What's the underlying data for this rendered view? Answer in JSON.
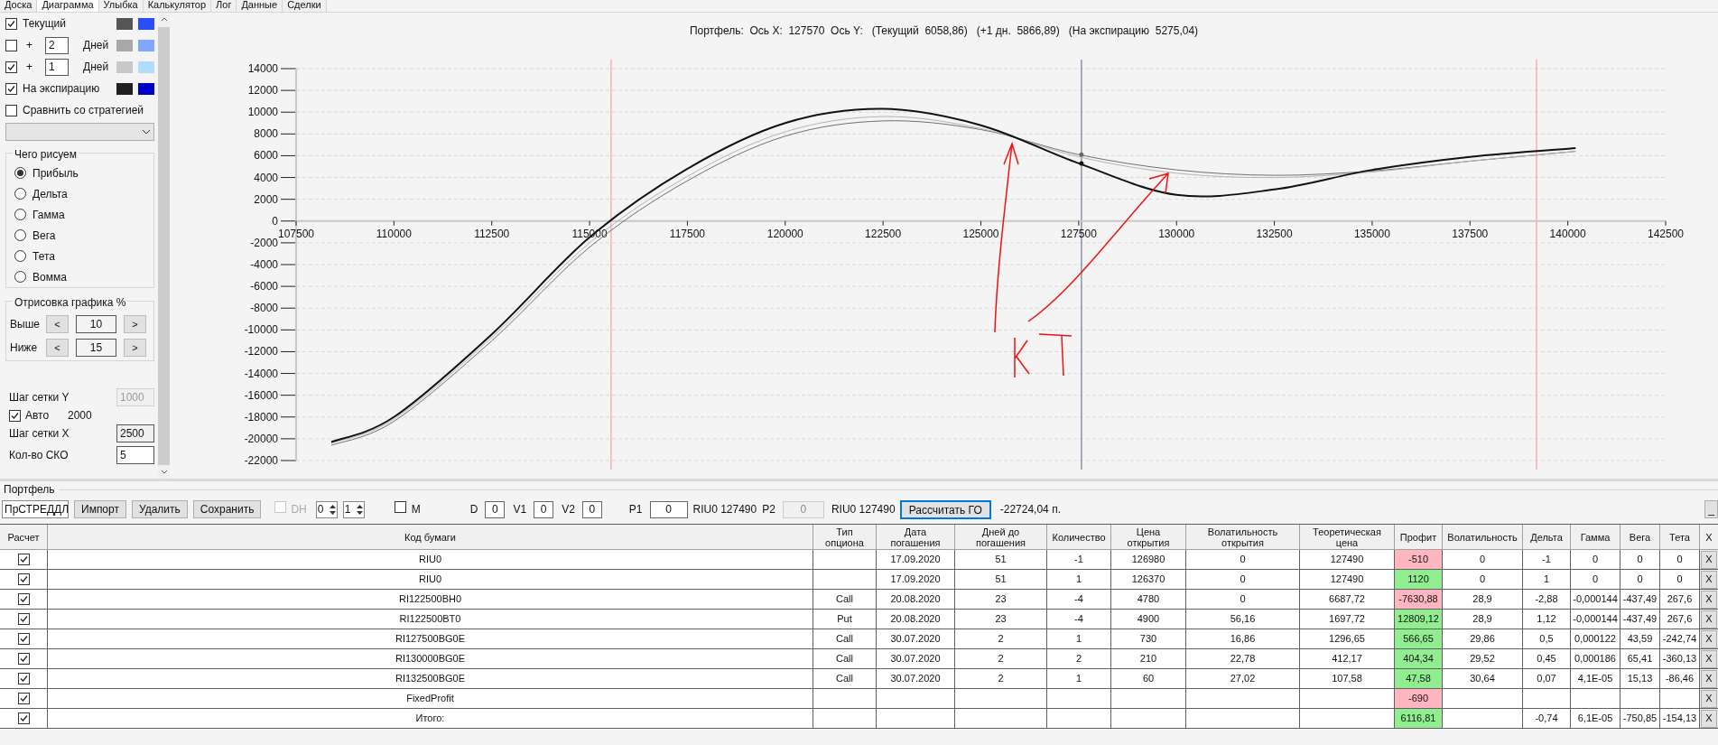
{
  "tabs": [
    {
      "label": "Доска",
      "selected": false
    },
    {
      "label": "Диаграмма",
      "selected": true
    },
    {
      "label": "Улыбка",
      "selected": false
    },
    {
      "label": "Калькулятор",
      "selected": false
    },
    {
      "label": "Лог",
      "selected": false
    },
    {
      "label": "Данные",
      "selected": false
    },
    {
      "label": "Сделки",
      "selected": false
    }
  ],
  "display_rows": [
    {
      "kind": "label",
      "label": "Текущий",
      "checked": true,
      "swatches": [
        {
          "color": "#555555"
        },
        {
          "color": "#2a4dff"
        }
      ]
    },
    {
      "kind": "days",
      "checked": false,
      "prefix": "+",
      "value": "2",
      "unit": "Дней",
      "swatches": [
        {
          "color": "#a8a8a8"
        },
        {
          "color": "#80a8ff"
        }
      ]
    },
    {
      "kind": "days",
      "checked": true,
      "prefix": "+",
      "value": "1",
      "unit": "Дней",
      "swatches": [
        {
          "color": "#c8c8c8"
        },
        {
          "color": "#b0dcff"
        }
      ]
    },
    {
      "kind": "label",
      "label": "На экспирацию",
      "checked": true,
      "swatches": [
        {
          "color": "#202020"
        },
        {
          "color": "#0000c8"
        }
      ]
    },
    {
      "kind": "label",
      "label": "Сравнить со стратегией",
      "checked": false
    }
  ],
  "plot_group": {
    "title": "Чего рисуем",
    "options": [
      {
        "label": "Прибыль",
        "selected": true
      },
      {
        "label": "Дельта",
        "selected": false
      },
      {
        "label": "Гамма",
        "selected": false
      },
      {
        "label": "Вега",
        "selected": false
      },
      {
        "label": "Тета",
        "selected": false
      },
      {
        "label": "Вомма",
        "selected": false
      }
    ]
  },
  "range_group": {
    "title": "Отрисовка графика %",
    "rows": [
      {
        "label": "Выше",
        "dec": "<",
        "value": "10",
        "inc": ">"
      },
      {
        "label": "Ниже",
        "dec": "<",
        "value": "15",
        "inc": ">"
      }
    ]
  },
  "grid_settings": [
    {
      "kind": "field",
      "label": "Шаг сетки Y",
      "value": "1000",
      "disabled": true,
      "readonly": false
    },
    {
      "kind": "check",
      "label": "Авто",
      "checked": true,
      "value": "2000"
    },
    {
      "kind": "field",
      "label": "Шаг сетки X",
      "value": "2500",
      "disabled": false,
      "readonly": true
    },
    {
      "kind": "field",
      "label": "Кол-во СКО",
      "value": "5",
      "disabled": false,
      "readonly": false
    }
  ],
  "chart": {
    "title": "Портфель:  Ось X:  127570  Ось Y:   (Текущий  6058,86)   (+1 дн.  5866,89)   (На экспирацию  5275,04)",
    "chart_data": {
      "type": "line",
      "x": [
        108400,
        110000,
        112500,
        115000,
        117500,
        120000,
        122500,
        125000,
        127500,
        130000,
        132500,
        135000,
        137500,
        140200
      ],
      "series": [
        {
          "color": "#707070",
          "values": [
            -20600,
            -18400,
            -11000,
            -2400,
            3700,
            7800,
            9200,
            8400,
            6100,
            4700,
            4200,
            4600,
            5500,
            6400
          ]
        },
        {
          "color": "#b4b4b4",
          "values": [
            -20400,
            -18200,
            -10700,
            -2000,
            4100,
            8200,
            9600,
            8500,
            5900,
            4400,
            4000,
            4500,
            5500,
            6400
          ]
        },
        {
          "color": "#111111",
          "values": [
            -20300,
            -18000,
            -10400,
            -1500,
            4800,
            9000,
            10300,
            8800,
            5300,
            2400,
            2900,
            4700,
            5900,
            6700
          ]
        }
      ],
      "xlim": [
        107500,
        142500
      ],
      "ylim": [
        -22000,
        14000
      ],
      "xticks": [
        107500,
        110000,
        112500,
        115000,
        117500,
        120000,
        122500,
        125000,
        127500,
        130000,
        132500,
        135000,
        137500,
        140000,
        142500
      ],
      "yticks": [
        14000,
        12000,
        10000,
        8000,
        6000,
        4000,
        2000,
        0,
        -2000,
        -4000,
        -6000,
        -8000,
        -10000,
        -12000,
        -14000,
        -16000,
        -18000,
        -20000,
        -22000
      ],
      "grid": true,
      "ref_lines": [
        {
          "axis": "x",
          "value": 115550,
          "color": "#ff8c8c"
        },
        {
          "axis": "x",
          "value": 139200,
          "color": "#ff8c8c"
        },
        {
          "axis": "x",
          "value": 127570,
          "color": "#8a94a6"
        }
      ]
    }
  },
  "portfolio": {
    "title": "Портфель",
    "strategy": "ПрСТРЕДДЛ",
    "buttons": [
      "Импорт",
      "Удалить",
      "Сохранить"
    ],
    "dh": {
      "label": "DH",
      "checked": false,
      "disabled": true
    },
    "spinners": [
      "0",
      "1"
    ],
    "m": {
      "label": "M",
      "checked": false
    },
    "params": [
      {
        "label": "D",
        "value": "0"
      },
      {
        "label": "V1",
        "value": "0"
      },
      {
        "label": "V2",
        "value": "0"
      },
      {
        "label": "P1",
        "value": "0"
      }
    ],
    "p1_info": "RIU0 127490",
    "p2": {
      "label": "P2",
      "value": "0",
      "disabled": true
    },
    "p2_info": "RIU0 127490",
    "calc_button": "Рассчитать ГО",
    "margin": "-22724,04 п.",
    "minimize": "_"
  },
  "table": {
    "columns": [
      "Расчет",
      "Код бумаги",
      "Тип опциона",
      "Дата погашения",
      "Дней до погашения",
      "Количество",
      "Цена открытия",
      "Волатильность открытия",
      "Теоретическая цена",
      "Профит",
      "Волатильность",
      "Дельта",
      "Гамма",
      "Вега",
      "Тета",
      "X"
    ],
    "rows": [
      {
        "checked": true,
        "code": "RIU0",
        "expiry": "17.09.2020",
        "days": "51",
        "qty": "-1",
        "open_price": "126980",
        "open_vol": "0",
        "theo": "127490",
        "profit": "-510",
        "color": "#ffb6c1",
        "vol": "0",
        "delta": "-1",
        "gamma": "0",
        "vega": "0",
        "theta": "0",
        "delete": "X"
      },
      {
        "checked": true,
        "code": "RIU0",
        "expiry": "17.09.2020",
        "days": "51",
        "qty": "1",
        "open_price": "126370",
        "open_vol": "0",
        "theo": "127490",
        "profit": "1120",
        "color": "#90ee90",
        "vol": "0",
        "delta": "1",
        "gamma": "0",
        "vega": "0",
        "theta": "0",
        "delete": "X"
      },
      {
        "checked": true,
        "code": "RI122500BH0",
        "type": "Call",
        "expiry": "20.08.2020",
        "days": "23",
        "qty": "-4",
        "open_price": "4780",
        "open_vol": "0",
        "theo": "6687,72",
        "profit": "-7630,88",
        "color": "#ffb6c1",
        "vol": "28,9",
        "delta": "-2,88",
        "gamma": "-0,000144",
        "vega": "-437,49",
        "theta": "267,6",
        "delete": "X"
      },
      {
        "checked": true,
        "code": "RI122500BT0",
        "type": "Put",
        "expiry": "20.08.2020",
        "days": "23",
        "qty": "-4",
        "open_price": "4900",
        "open_vol": "56,16",
        "theo": "1697,72",
        "profit": "12809,12",
        "color": "#90ee90",
        "vol": "28,9",
        "delta": "1,12",
        "gamma": "-0,000144",
        "vega": "-437,49",
        "theta": "267,6",
        "delete": "X"
      },
      {
        "checked": true,
        "code": "RI127500BG0E",
        "type": "Call",
        "expiry": "30.07.2020",
        "days": "2",
        "qty": "1",
        "open_price": "730",
        "open_vol": "16,86",
        "theo": "1296,65",
        "profit": "566,65",
        "color": "#90ee90",
        "vol": "29,86",
        "delta": "0,5",
        "gamma": "0,000122",
        "vega": "43,59",
        "theta": "-242,74",
        "delete": "X"
      },
      {
        "checked": true,
        "code": "RI130000BG0E",
        "type": "Call",
        "expiry": "30.07.2020",
        "days": "2",
        "qty": "2",
        "open_price": "210",
        "open_vol": "22,78",
        "theo": "412,17",
        "profit": "404,34",
        "color": "#90ee90",
        "vol": "29,52",
        "delta": "0,45",
        "gamma": "0,000186",
        "vega": "65,41",
        "theta": "-360,13",
        "delete": "X"
      },
      {
        "checked": true,
        "code": "RI132500BG0E",
        "type": "Call",
        "expiry": "30.07.2020",
        "days": "2",
        "qty": "1",
        "open_price": "60",
        "open_vol": "27,02",
        "theo": "107,58",
        "profit": "47,58",
        "color": "#90ee90",
        "vol": "30,64",
        "delta": "0,07",
        "gamma": "4,1E-05",
        "vega": "15,13",
        "theta": "-86,46",
        "delete": "X"
      },
      {
        "checked": true,
        "code": "FixedProfit",
        "profit": "-690",
        "color": "#ffb6c1",
        "delete": "X"
      },
      {
        "checked": true,
        "code": "Итого:",
        "profit": "6116,81",
        "color": "#90ee90",
        "delta": "-0,74",
        "gamma": "6,1E-05",
        "vega": "-750,85",
        "theta": "-154,13",
        "delete": "X"
      }
    ]
  }
}
